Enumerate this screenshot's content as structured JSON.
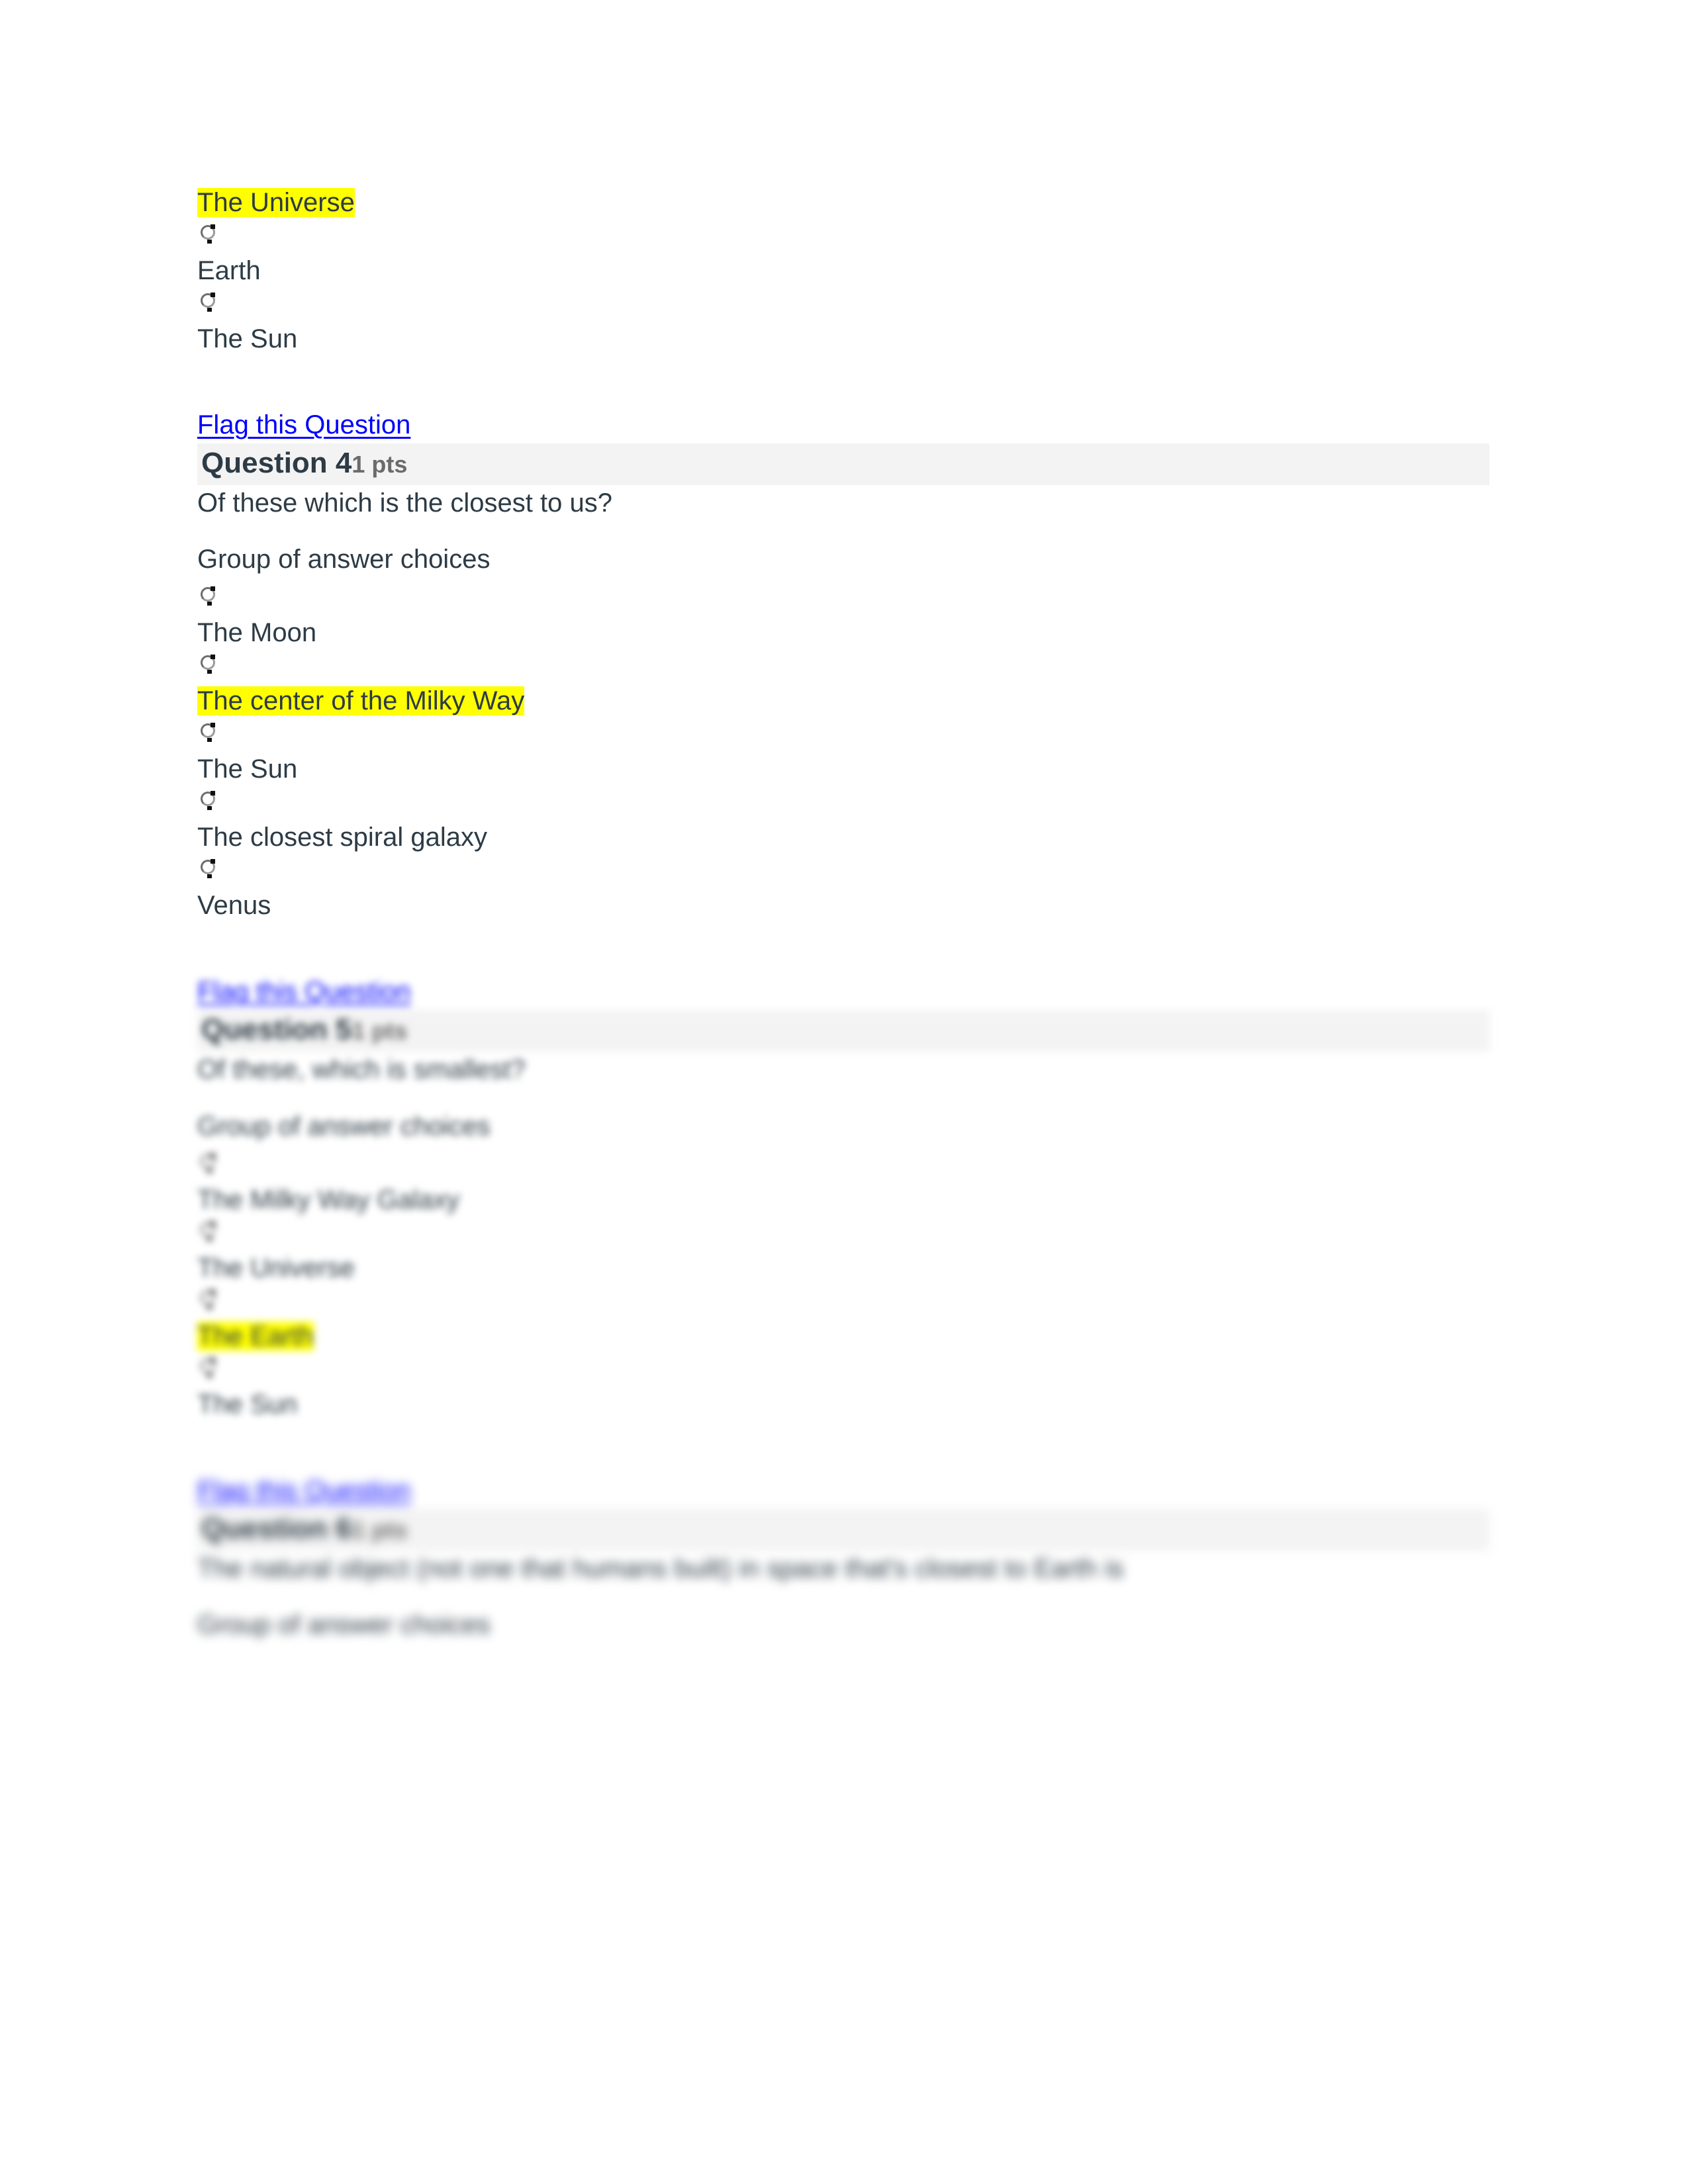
{
  "document": {
    "kind": "quiz-page",
    "highlight_color": "#ffff00",
    "link_color": "#0000ff",
    "text_color": "#2d3b45",
    "header_band_color": "#f3f3f3"
  },
  "question_3_tail": {
    "choices": [
      {
        "label": "The Universe",
        "highlighted": true,
        "selected": false
      },
      {
        "label": "Earth",
        "highlighted": false,
        "selected": false
      },
      {
        "label": "The Sun",
        "highlighted": false,
        "selected": false
      }
    ]
  },
  "flag_label": "Flag this Question",
  "questions": [
    {
      "number_label": "Question 4",
      "points_label": "1 pts",
      "prompt": "Of these which is the closest to us?",
      "group_label": "Group of answer choices",
      "choices": [
        {
          "label": "The Moon",
          "highlighted": false
        },
        {
          "label": "The center of the Milky Way",
          "highlighted": true
        },
        {
          "label": "The Sun",
          "highlighted": false
        },
        {
          "label": "The closest spiral galaxy",
          "highlighted": false
        },
        {
          "label": "Venus",
          "highlighted": false
        }
      ]
    },
    {
      "number_label": "Question 5",
      "points_label": "1 pts",
      "prompt": "Of these, which is smallest?",
      "group_label": "Group of answer choices",
      "choices": [
        {
          "label": "The Milky Way Galaxy",
          "highlighted": false
        },
        {
          "label": "The Universe",
          "highlighted": false
        },
        {
          "label": "The Earth",
          "highlighted": true
        },
        {
          "label": "The Sun",
          "highlighted": false
        }
      ]
    },
    {
      "number_label": "Question 6",
      "points_label": "1 pts",
      "prompt": "The natural object (not one that humans built) in space that's closest to Earth is",
      "group_label": "Group of answer choices",
      "choices": []
    }
  ]
}
